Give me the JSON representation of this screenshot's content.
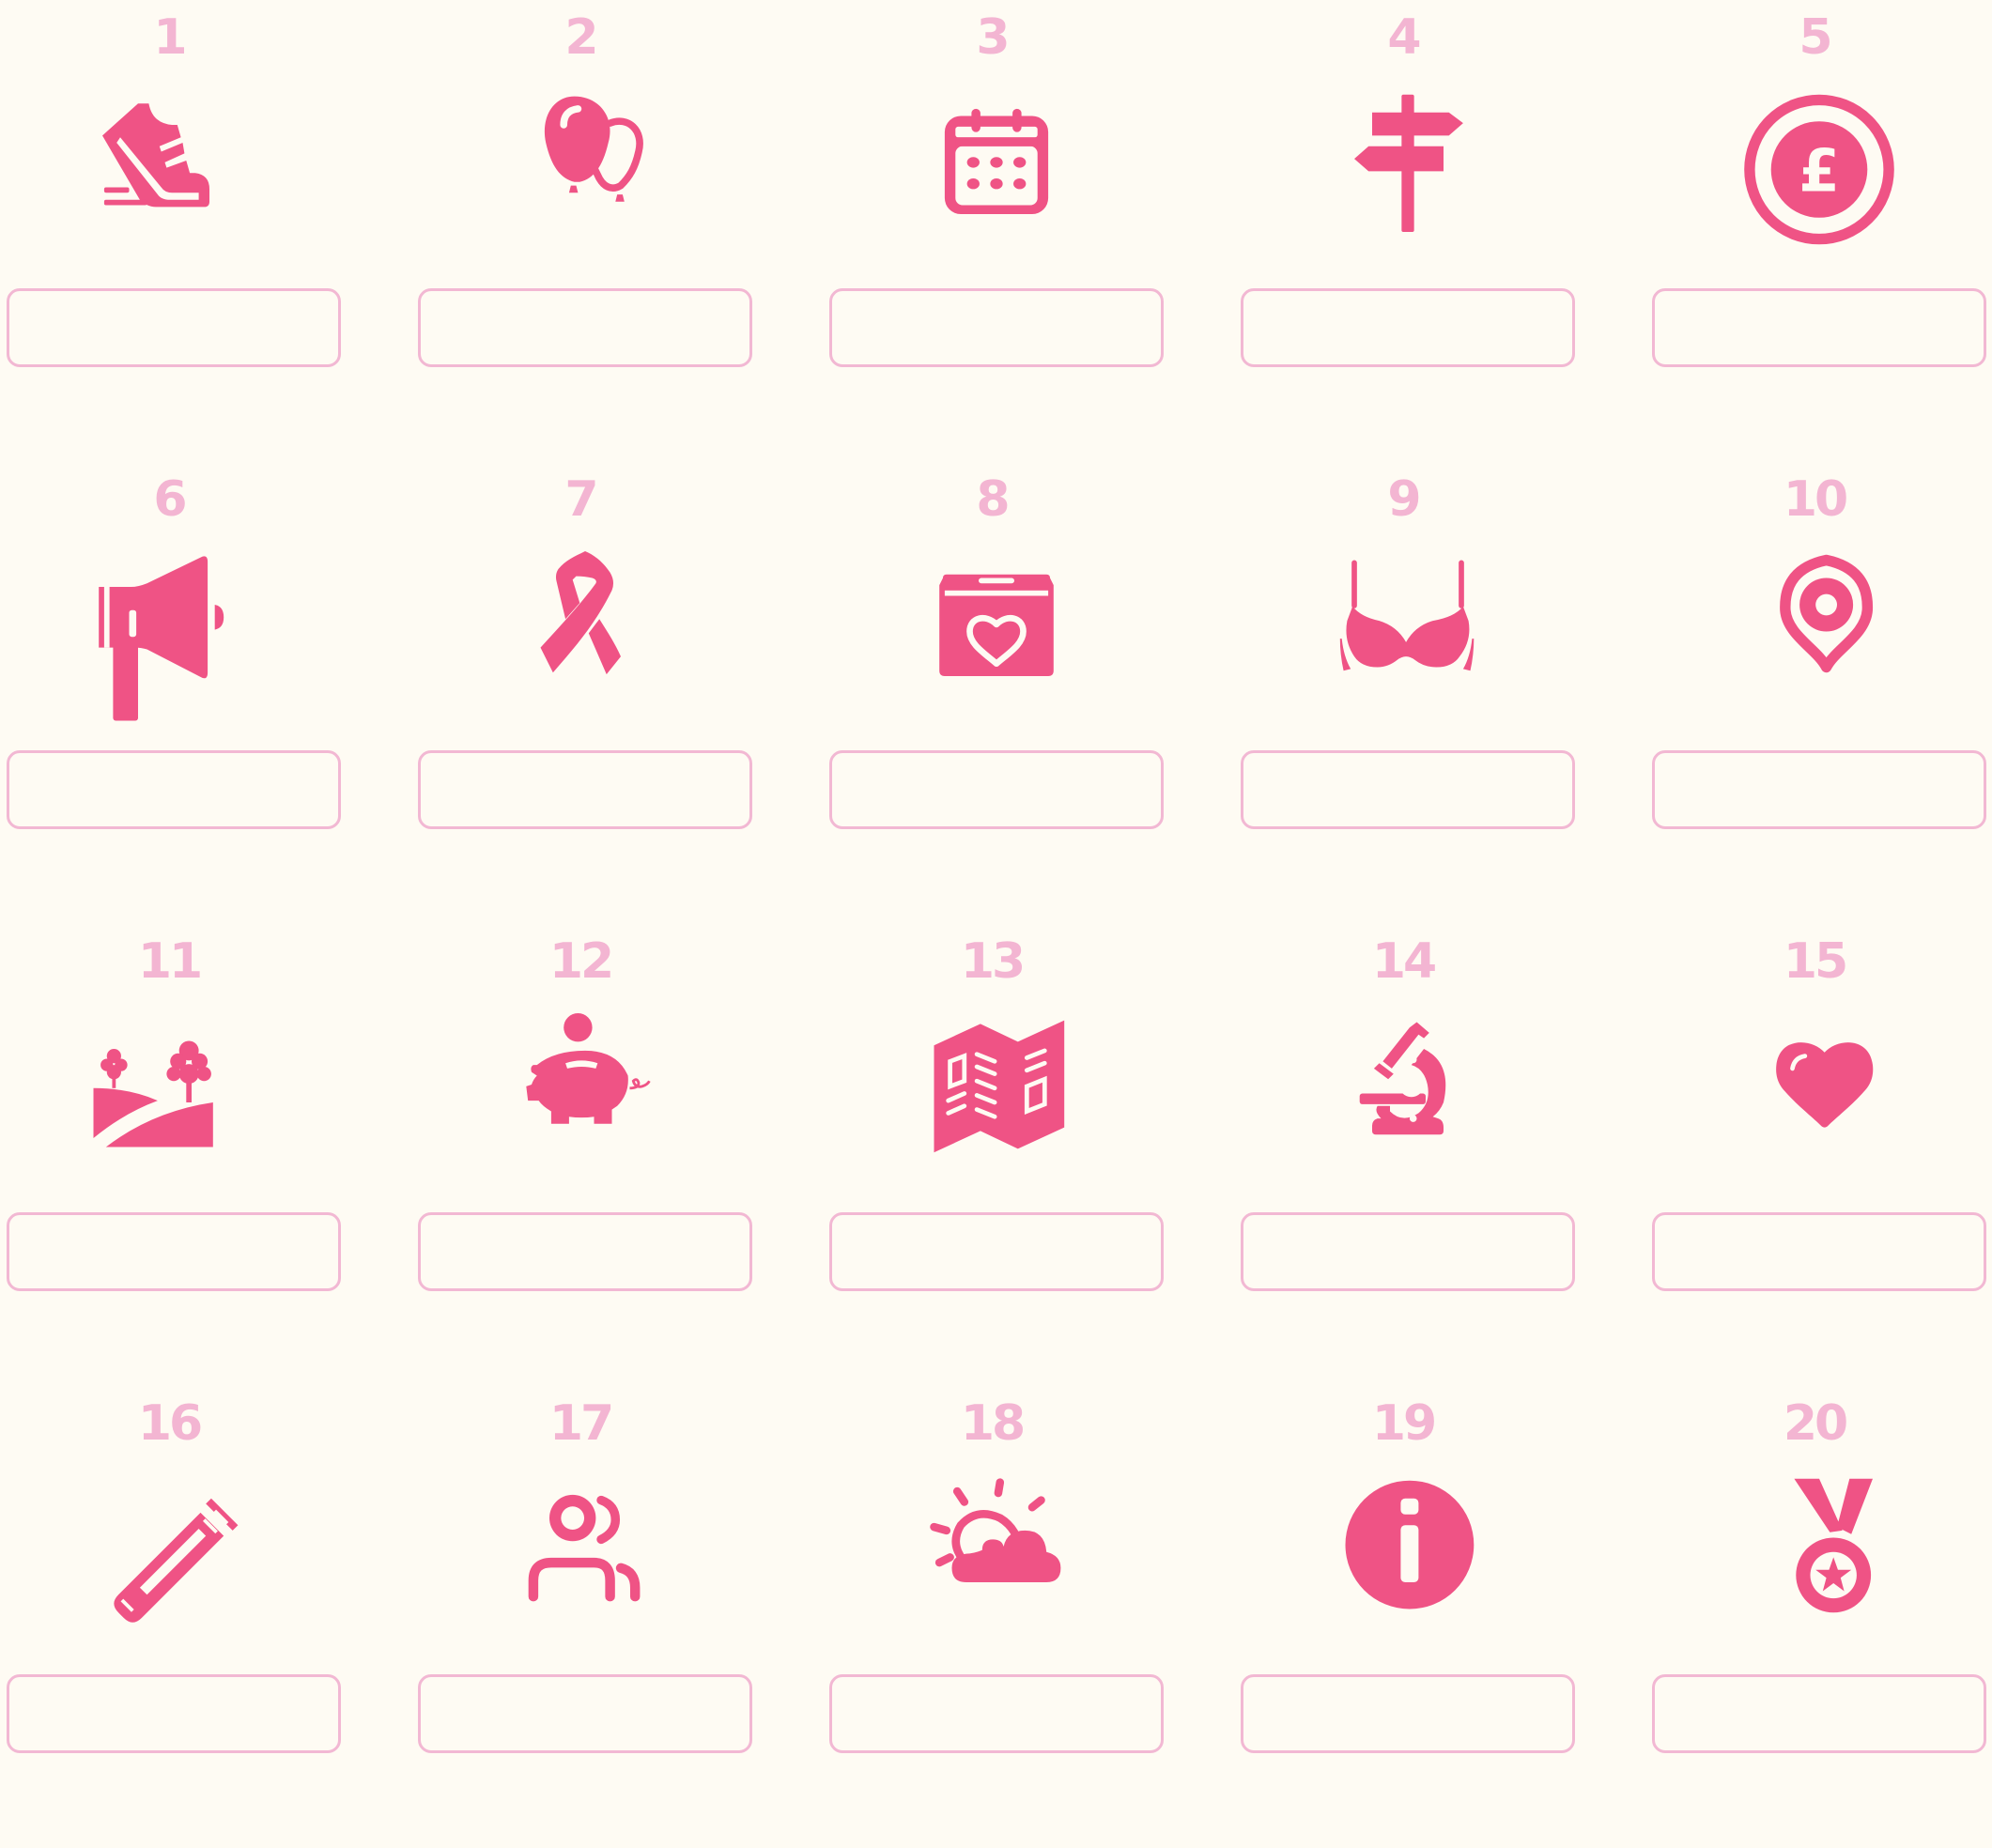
{
  "colors": {
    "background": "#fefbf3",
    "icon": "#ef5385",
    "number": "#f3b5d2",
    "box_border": "#f2b8d3"
  },
  "items": [
    {
      "number": "1",
      "icon": "running-shoe-icon",
      "answer": ""
    },
    {
      "number": "2",
      "icon": "balloons-icon",
      "answer": ""
    },
    {
      "number": "3",
      "icon": "calendar-icon",
      "answer": ""
    },
    {
      "number": "4",
      "icon": "signpost-icon",
      "answer": ""
    },
    {
      "number": "5",
      "icon": "pound-coin-icon",
      "answer": ""
    },
    {
      "number": "6",
      "icon": "megaphone-icon",
      "answer": ""
    },
    {
      "number": "7",
      "icon": "awareness-ribbon-icon",
      "answer": ""
    },
    {
      "number": "8",
      "icon": "donation-box-icon",
      "answer": ""
    },
    {
      "number": "9",
      "icon": "bra-icon",
      "answer": ""
    },
    {
      "number": "10",
      "icon": "location-pin-icon",
      "answer": ""
    },
    {
      "number": "11",
      "icon": "park-hills-icon",
      "answer": ""
    },
    {
      "number": "12",
      "icon": "piggy-bank-icon",
      "answer": ""
    },
    {
      "number": "13",
      "icon": "map-leaflet-icon",
      "answer": ""
    },
    {
      "number": "14",
      "icon": "microscope-icon",
      "answer": ""
    },
    {
      "number": "15",
      "icon": "heart-icon",
      "answer": ""
    },
    {
      "number": "16",
      "icon": "test-tube-icon",
      "answer": ""
    },
    {
      "number": "17",
      "icon": "people-icon",
      "answer": ""
    },
    {
      "number": "18",
      "icon": "sun-cloud-icon",
      "answer": ""
    },
    {
      "number": "19",
      "icon": "info-icon",
      "answer": ""
    },
    {
      "number": "20",
      "icon": "medal-icon",
      "answer": ""
    }
  ]
}
